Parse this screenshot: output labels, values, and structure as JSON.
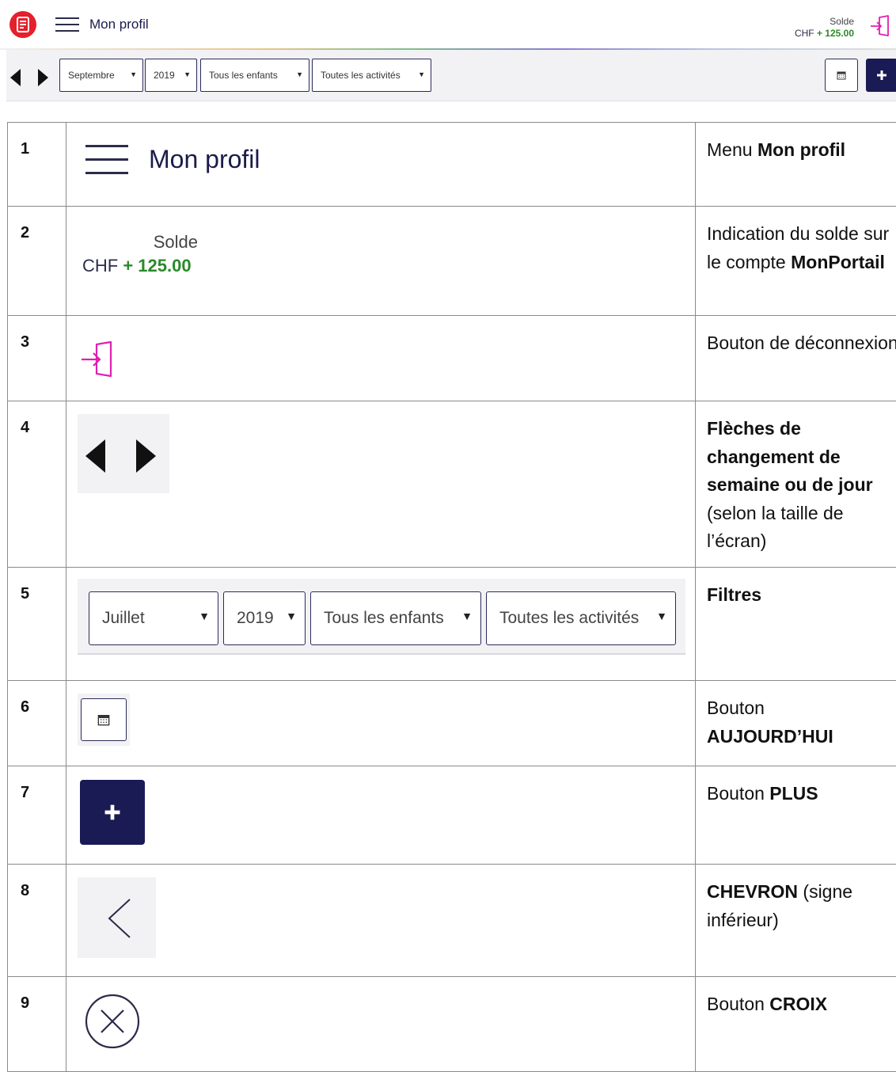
{
  "header": {
    "title": "Mon profil",
    "solde_label": "Solde",
    "currency": "CHF",
    "amount": "+ 125.00"
  },
  "toolbar": {
    "month": "Septembre",
    "year": "2019",
    "children": "Tous les enfants",
    "activities": "Toutes les activités"
  },
  "legend": {
    "rows": [
      {
        "num": "1",
        "desc_pre": "Menu ",
        "desc_bold": "Mon profil",
        "desc_post": "",
        "visual_title": "Mon profil"
      },
      {
        "num": "2",
        "desc_pre": "Indication du solde sur le compte ",
        "desc_bold": "MonPortail",
        "desc_post": "",
        "visual_label": "Solde",
        "visual_currency": "CHF",
        "visual_amount": "+ 125.00"
      },
      {
        "num": "3",
        "desc_pre": "Bouton de déconnexion",
        "desc_bold": "",
        "desc_post": ""
      },
      {
        "num": "4",
        "desc_pre": "",
        "desc_bold": "Flèches de changement de semaine ou de jour",
        "desc_post": " (selon la taille de l’écran)"
      },
      {
        "num": "5",
        "desc_pre": "",
        "desc_bold": "Filtres",
        "desc_post": "",
        "filters": {
          "month": "Juillet",
          "year": "2019",
          "children": "Tous les enfants",
          "activities": "Toutes les activités"
        }
      },
      {
        "num": "6",
        "desc_pre": "Bouton ",
        "desc_bold": "AUJOURD’HUI",
        "desc_post": ""
      },
      {
        "num": "7",
        "desc_pre": "Bouton ",
        "desc_bold": "PLUS",
        "desc_post": ""
      },
      {
        "num": "8",
        "desc_pre": "",
        "desc_bold": "CHEVRON",
        "desc_post": " (signe inférieur)"
      },
      {
        "num": "9",
        "desc_pre": "Bouton ",
        "desc_bold": "CROIX",
        "desc_post": ""
      }
    ]
  },
  "icons": {
    "logo": "calendar-phone-logo-icon",
    "menu": "hamburger-icon",
    "logout": "logout-door-icon",
    "prev": "triangle-left-icon",
    "next": "triangle-right-icon",
    "today": "calendar-icon",
    "plus": "plus-icon",
    "chevron": "chevron-left-icon",
    "close": "close-circle-icon"
  },
  "colors": {
    "brand_red": "#e4202c",
    "navy": "#1a1a54",
    "amount_green": "#2a8a2a",
    "logout_pink": "#e020b0"
  }
}
